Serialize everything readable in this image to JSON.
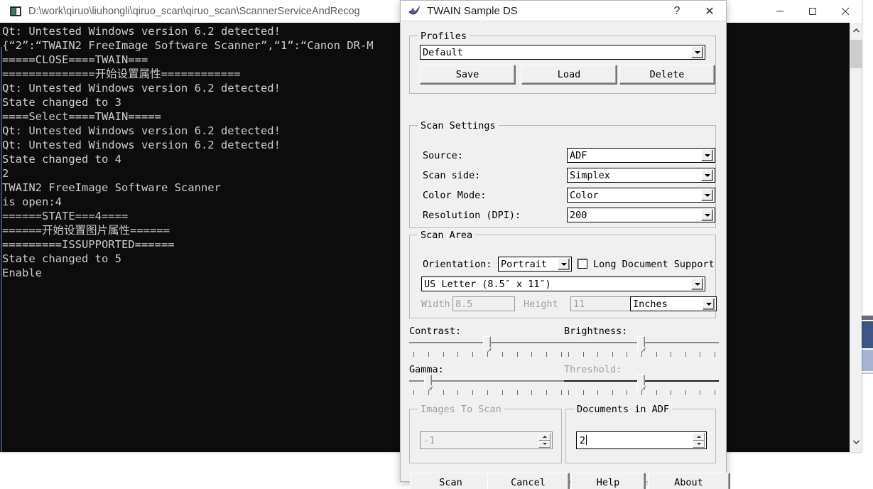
{
  "console_window": {
    "title": "D:\\work\\qiruo\\liuhongli\\qiruo_scan\\qiruo_scan\\ScannerServiceAndRecog",
    "icon": "cmd-icon",
    "controls": {
      "minimize": "minimize-icon",
      "maximize": "maximize-icon",
      "close": "close-icon"
    },
    "scrollbar": {
      "up": "▲",
      "down": "▼"
    },
    "output": "Qt: Untested Windows version 6.2 detected!\n{“2”:“TWAIN2 FreeImage Software Scanner”,“1”:“Canon DR-M\n=====CLOSE====TWAIN===\n==============开始设置属性============\nQt: Untested Windows version 6.2 detected!\nState changed to 3\n====Select====TWAIN=====\nQt: Untested Windows version 6.2 detected!\nQt: Untested Windows version 6.2 detected!\nState changed to 4\n2\nTWAIN2 FreeImage Software Scanner\nis open:4\n======STATE===4====\n======开始设置图片属性======\n=========ISSUPPORTED======\nState changed to 5\nEnable"
  },
  "dialog": {
    "title": "TWAIN Sample DS",
    "icon": "swallow-bird-icon",
    "help_button": "?",
    "close_button": "✕",
    "profiles": {
      "legend": "Profiles",
      "selected": "Default",
      "save_label": "Save",
      "load_label": "Load",
      "delete_label": "Delete"
    },
    "scan_settings": {
      "legend": "Scan Settings",
      "rows": [
        {
          "label": "Source:",
          "value": "ADF"
        },
        {
          "label": "Scan side:",
          "value": "Simplex"
        },
        {
          "label": "Color Mode:",
          "value": "Color"
        },
        {
          "label": "Resolution (DPI):",
          "value": "200"
        }
      ]
    },
    "scan_area": {
      "legend": "Scan Area",
      "orientation_label": "Orientation:",
      "orientation_value": "Portrait",
      "long_document_label": "Long Document Support",
      "long_document_checked": false,
      "paper_size": "US Letter (8.5″ x 11″)",
      "width_label": "Width",
      "width_value": "8.5",
      "height_label": "Height",
      "height_value": "11",
      "units_value": "Inches"
    },
    "sliders": {
      "contrast": {
        "label": "Contrast:",
        "position_pct": 50,
        "ticks": 11,
        "disabled": false
      },
      "brightness": {
        "label": "Brightness:",
        "position_pct": 50,
        "ticks": 11,
        "disabled": false
      },
      "gamma": {
        "label": "Gamma:",
        "position_pct": 10,
        "ticks": 11,
        "disabled": false
      },
      "threshold": {
        "label": "Threshold:",
        "position_pct": 50,
        "ticks": 11,
        "disabled": true
      }
    },
    "images_to_scan": {
      "legend": "Images To Scan",
      "value": "-1",
      "disabled": true
    },
    "documents_in_adf": {
      "legend": "Documents in ADF",
      "value": "2",
      "disabled": false
    },
    "actions": {
      "scan": "Scan",
      "cancel": "Cancel",
      "help": "Help",
      "about": "About"
    }
  }
}
